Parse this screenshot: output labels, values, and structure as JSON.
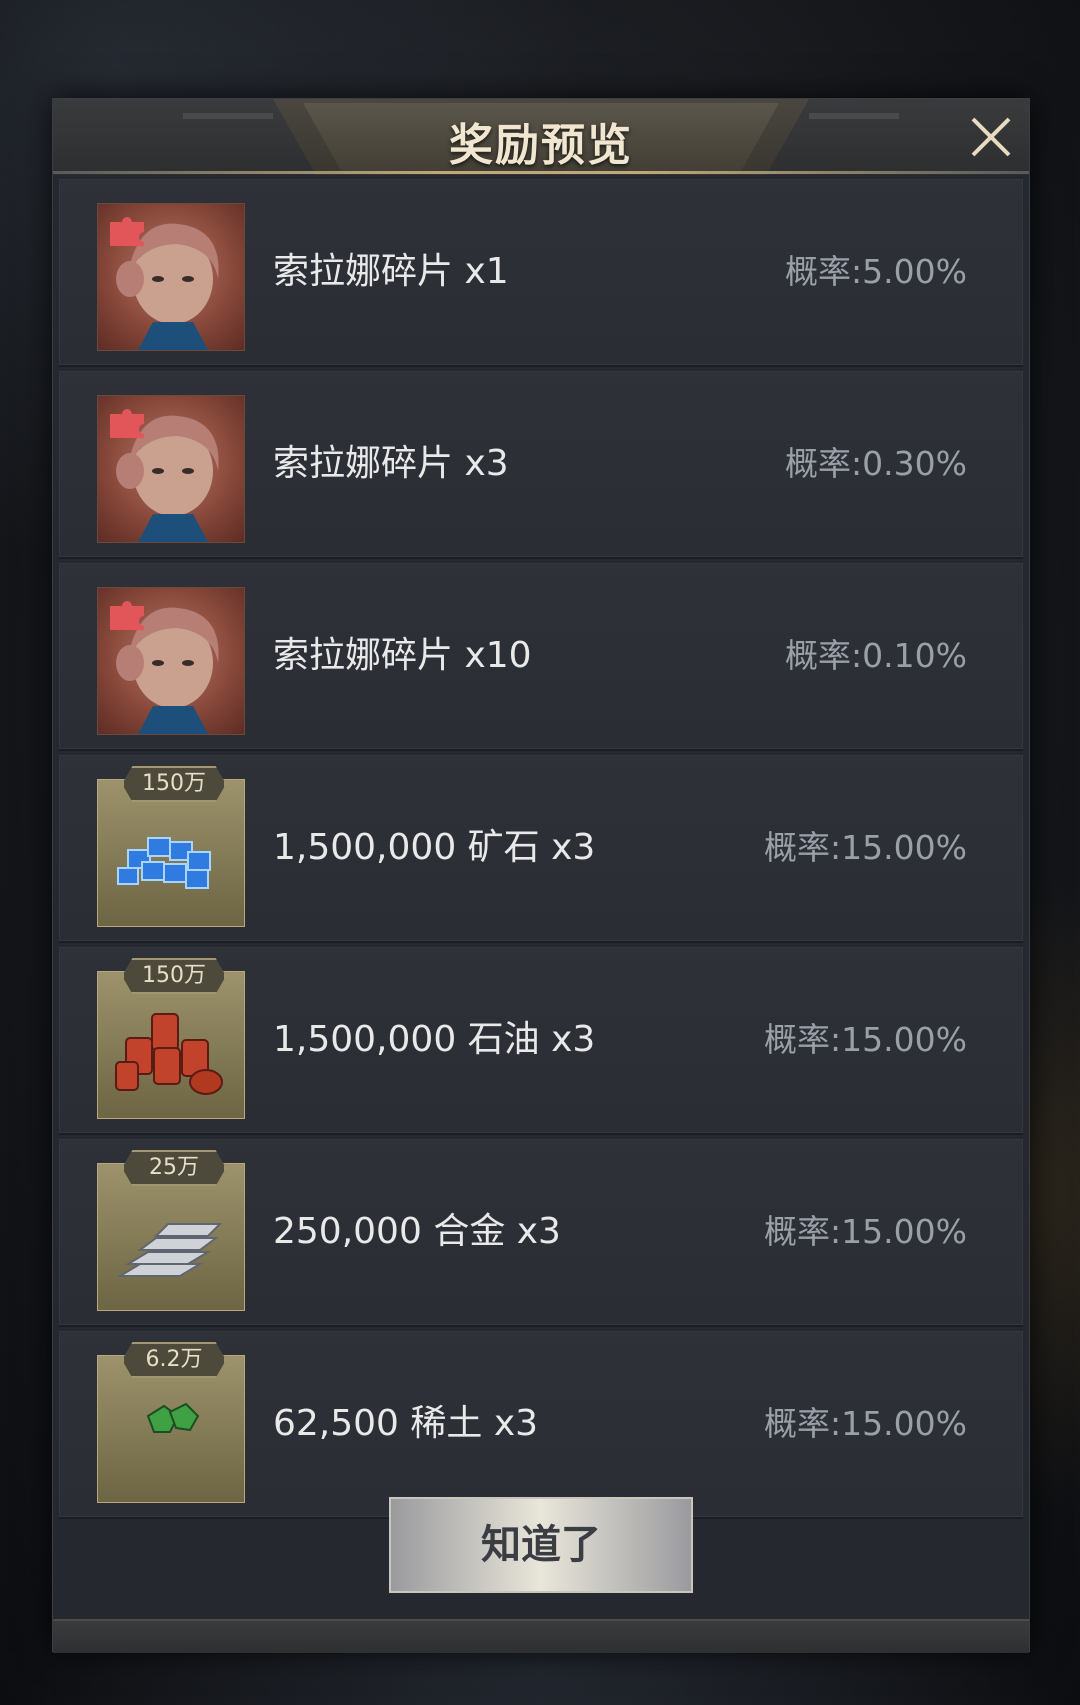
{
  "dialog": {
    "title": "奖励预览",
    "confirm_label": "知道了"
  },
  "rewards": [
    {
      "icon": "hero-fragment-icon",
      "tag": "",
      "name": "索拉娜碎片 x1",
      "prob": "概率:5.00%"
    },
    {
      "icon": "hero-fragment-icon",
      "tag": "",
      "name": "索拉娜碎片 x3",
      "prob": "概率:0.30%"
    },
    {
      "icon": "hero-fragment-icon",
      "tag": "",
      "name": "索拉娜碎片 x10",
      "prob": "概率:0.10%"
    },
    {
      "icon": "ore-icon",
      "tag": "150万",
      "name": "1,500,000  矿石 x3",
      "prob": "概率:15.00%"
    },
    {
      "icon": "oil-barrels-icon",
      "tag": "150万",
      "name": "1,500,000  石油 x3",
      "prob": "概率:15.00%"
    },
    {
      "icon": "alloy-ingots-icon",
      "tag": "25万",
      "name": "250,000  合金 x3",
      "prob": "概率:15.00%"
    },
    {
      "icon": "rare-earth-icon",
      "tag": "6.2万",
      "name": "62,500  稀土 x3",
      "prob": "概率:15.00%"
    }
  ],
  "colors": {
    "accent_gold": "#bfa97a",
    "panel_bg": "#25282e",
    "text_primary": "#e9e9ea",
    "text_secondary": "#9aa0a8"
  }
}
